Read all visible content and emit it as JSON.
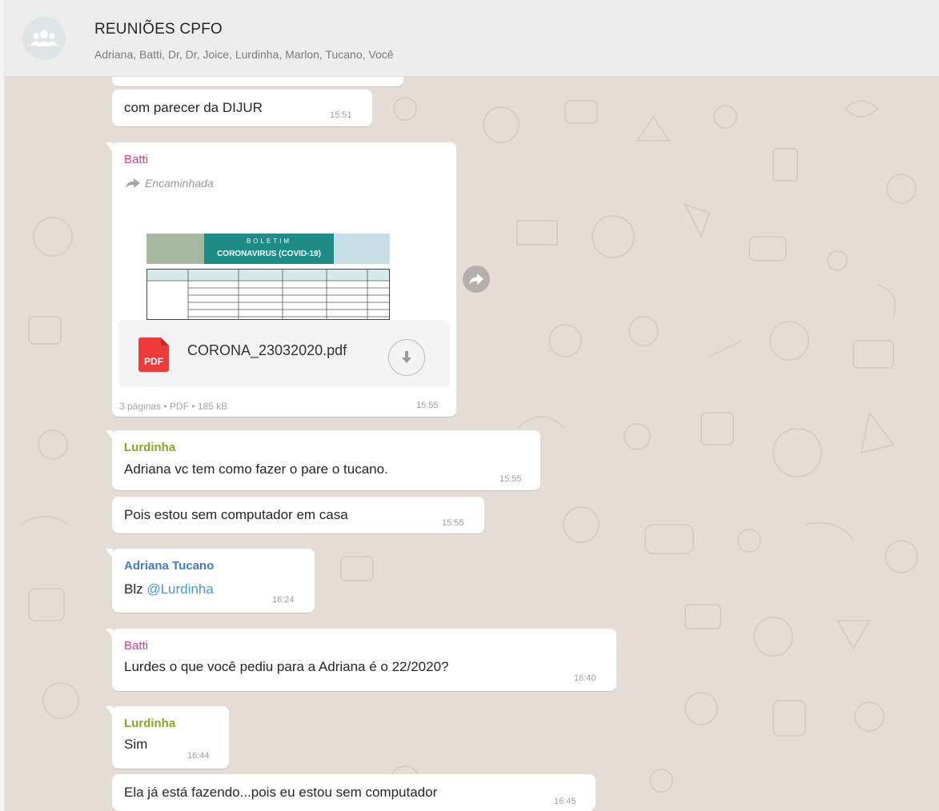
{
  "header": {
    "title": "REUNIÕES CPFO",
    "members": "Adriana, Batti, Dr, Dr, Joice, Lurdinha, Marlon, Tucano, Você",
    "avatar_icon": "group-icon"
  },
  "colors": {
    "chat_background": "#e5ddd5",
    "header_background": "#ededed",
    "batti": "#d6408b",
    "lurdinha": "#8fa225",
    "adriana_tucano": "#3d7cc9",
    "mention": "#3e9bd6",
    "pdf_red": "#ee3a3a"
  },
  "messages": [
    {
      "text": "com parecer da DIJUR",
      "time": "15:51"
    },
    {
      "sender": "Batti",
      "forwarded_label": "Encaminhada",
      "document": {
        "preview_heading": "BOLETIM",
        "preview_subheading": "CORONAVIRUS (COVID-19)",
        "file_name": "CORONA_23032020.pdf",
        "file_icon_label": "PDF",
        "meta": "3 páginas • PDF • 185 kB"
      },
      "time": "15:55"
    },
    {
      "sender": "Lurdinha",
      "text": "Adriana vc tem como fazer o pare o tucano.",
      "time": "15:55"
    },
    {
      "text": "Pois estou sem computador em casa",
      "time": "15:55"
    },
    {
      "sender": "Adriana Tucano",
      "text": "Blz ",
      "mention": "@Lurdinha",
      "time": "16:24"
    },
    {
      "sender": "Batti",
      "text": "Lurdes o que você pediu para a Adriana é o 22/2020?",
      "time": "16:40"
    },
    {
      "sender": "Lurdinha",
      "text": "Sim",
      "time": "16:44"
    },
    {
      "text": "Ela já está fazendo...pois eu estou sem computador",
      "time": "16:45"
    }
  ]
}
